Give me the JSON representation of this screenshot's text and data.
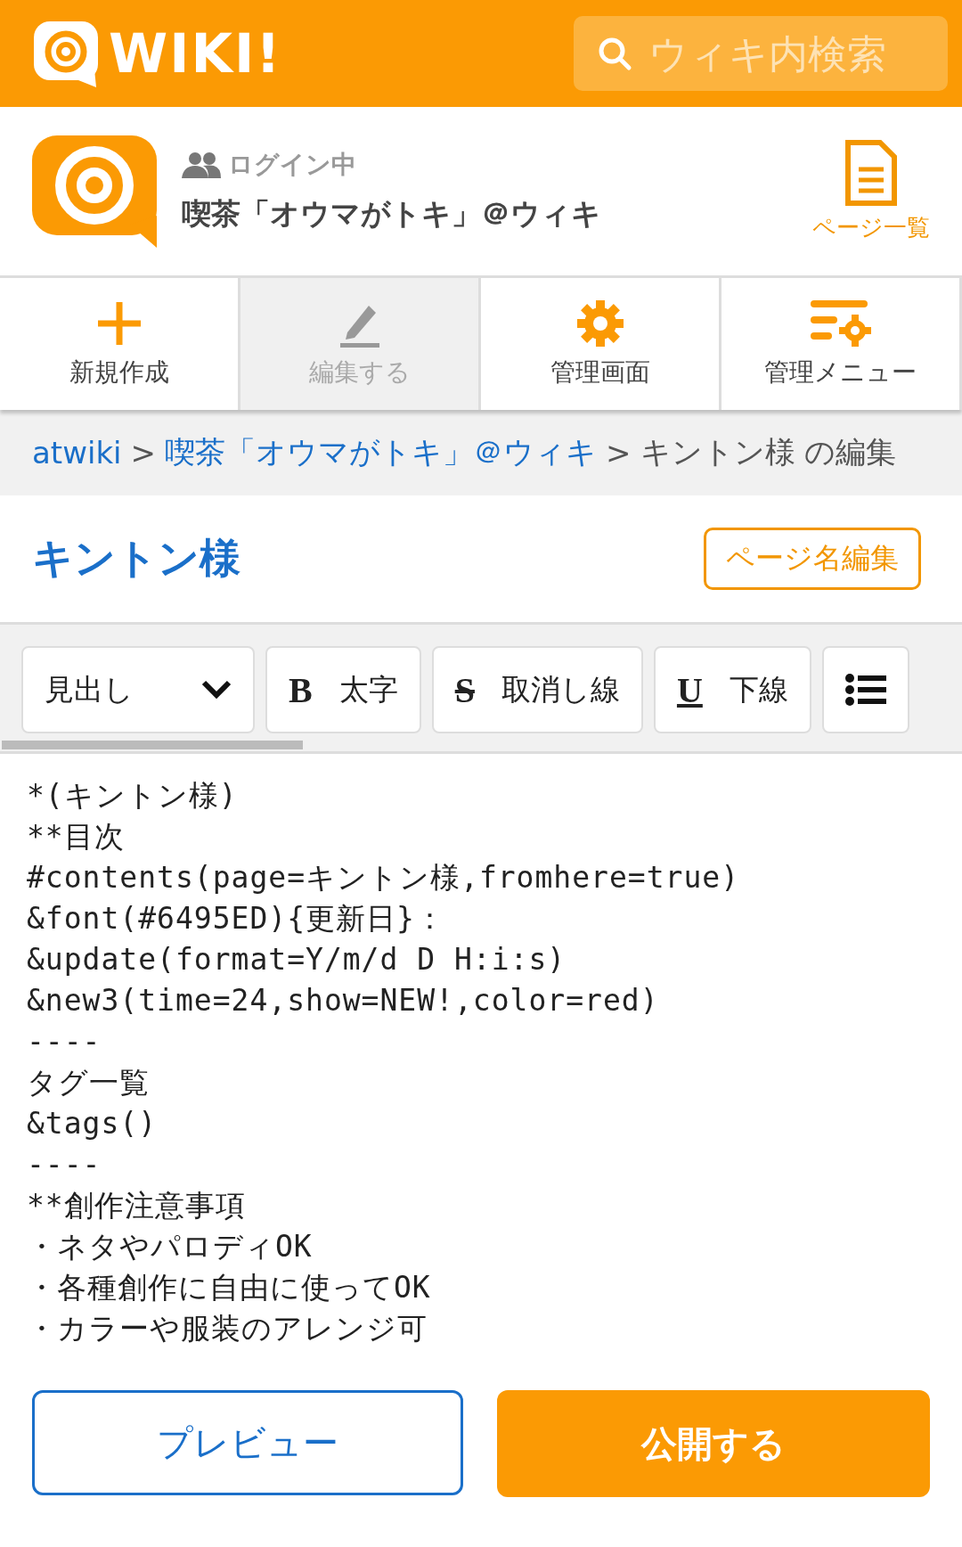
{
  "header": {
    "logo": "WIKI!",
    "search": {
      "placeholder": "ウィキ内検索"
    }
  },
  "site": {
    "status": "ログイン中",
    "name": "喫茶「オウマがトキ」＠ウィキ",
    "page_list": "ページ一覧"
  },
  "toolbar": [
    {
      "kind": "new",
      "label": "新規作成",
      "disabled": false
    },
    {
      "kind": "edit",
      "label": "編集する",
      "disabled": true
    },
    {
      "kind": "admin",
      "label": "管理画面",
      "disabled": false
    },
    {
      "kind": "menu",
      "label": "管理メニュー",
      "disabled": false
    }
  ],
  "breadcrumb": [
    {
      "text": "atwiki",
      "link": true
    },
    {
      "text": ">",
      "link": false
    },
    {
      "text": "喫茶「オウマがトキ」＠ウィキ",
      "link": true
    },
    {
      "text": ">",
      "link": false
    },
    {
      "text": "キントン様 の編集",
      "link": false
    }
  ],
  "page_title": "キントン様",
  "rename_button": "ページ名編集",
  "format_bar": [
    {
      "kind": "dropdown",
      "label": "見出し"
    },
    {
      "kind": "bold",
      "icon": "B",
      "label": "太字"
    },
    {
      "kind": "strike",
      "icon": "S",
      "label": "取消し線"
    },
    {
      "kind": "underline",
      "icon": "U",
      "label": "下線"
    },
    {
      "kind": "list"
    }
  ],
  "editor_lines": [
    "*(キントン様)",
    "**目次",
    "#contents(page=キントン様,fromhere=true)",
    "&font(#6495ED){更新日}：",
    "&update(format=Y/m/d D H:i:s)",
    "&new3(time=24,show=NEW!,color=red)",
    "----",
    "タグ一覧",
    "&tags()",
    "----",
    "**創作注意事項",
    "・ネタやパロディOK",
    "・各種創作に自由に使ってOK",
    "・カラーや服装のアレンジ可"
  ],
  "buttons": {
    "preview": "プレビュー",
    "publish": "公開する"
  }
}
